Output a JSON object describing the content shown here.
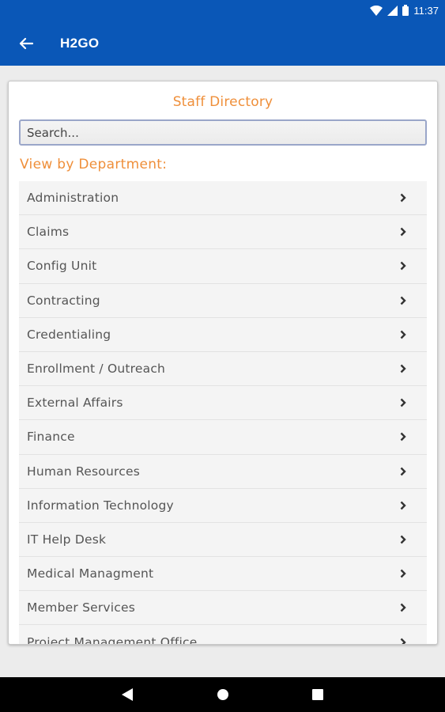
{
  "status": {
    "time": "11:37"
  },
  "app_bar": {
    "title": "H2GO"
  },
  "card": {
    "title": "Staff Directory",
    "search_placeholder": "Search...",
    "section_label": "View by Department:"
  },
  "departments": [
    "Administration",
    "Claims",
    "Config Unit",
    "Contracting",
    "Credentialing",
    "Enrollment / Outreach",
    "External Affairs",
    "Finance",
    "Human Resources",
    "Information Technology",
    "IT Help Desk",
    "Medical Managment",
    "Member Services",
    "Project Management Office"
  ],
  "colors": {
    "primary": "#0a57b7",
    "accent": "#ef8f3a"
  },
  "icons": {
    "back": "arrow-left-icon",
    "row": "chevron-right-icon",
    "nav_back": "triangle-back-icon",
    "nav_home": "circle-home-icon",
    "nav_recents": "square-recents-icon"
  }
}
